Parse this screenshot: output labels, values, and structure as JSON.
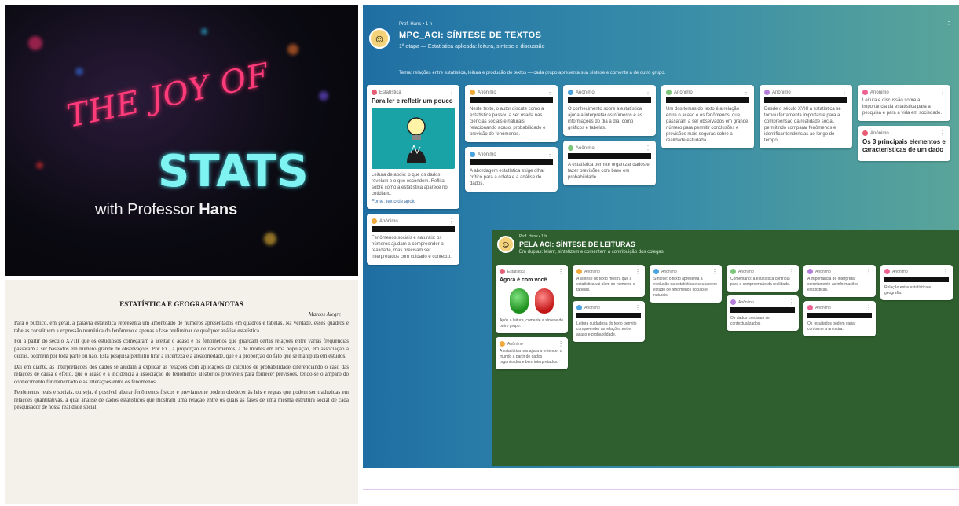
{
  "video": {
    "title_line1": "THE JOY OF",
    "title_line2": "STATS",
    "byline_prefix": "with Professor",
    "byline_name": "Hans"
  },
  "document": {
    "title": "ESTATÍSTICA E GEOGRAFIA/NOTAS",
    "author": "Marcos Alegre",
    "paragraphs": [
      "Para o público, em geral, a palavra estatística representa um amontoado de números apresentados em quadros e tabelas. Na verdade, esses quadros e tabelas constituem a expressão numérica do fenômeno e apenas a fase preliminar de qualquer análise estatística.",
      "Foi a partir do século XVIII que os estudiosos começaram a aceitar o acaso e os fenômenos que guardam certas relações entre várias freqüências passaram a ser baseados em número grande de observações. Por Ex., a proporção de nascimentos, a de mortes em uma população, em associação a outras, ocorrem por toda parte ou não. Esta pesquisa permitiu tirar a incerteza e a aleatoriedade, que é a proporção do fato que se manipula em estudos.",
      "Daí em diante, as interpretações dos dados se ajudam a explicar as relações com aplicações de cálculos de probabilidade diferenciando o caso das relações de causa e efeito, que o acaso é a incidência a associação de fenômenos aleatórios prováveis para fornecer previsões, tendo-se o amparo do conhecimento fundamentado e as interações entre os fenômenos.",
      "Fenômenos reais e sociais, ou seja, é possível alterar fenômenos físicos e previamente podem obedecer às leis e regras que podem ser traduzidas em relações quantitativas, a qual análise de dados estatísticos que mostram uma relação entre os quais as fases de uma mesma estrutura social de cada pesquisador de nossa realidade social."
    ]
  },
  "board1": {
    "owner": "Prof. Hans • 1 h",
    "title": "MPC_ACI: SÍNTESE DE TEXTOS",
    "subtitle": "1ª etapa — Estatística aplicada: leitura, síntese e discussão",
    "description": "Tema: relações entre estatística, leitura e produção de textos — cada grupo apresenta sua síntese e comenta a de outro grupo.",
    "menu": "⋮",
    "columns": [
      {
        "cards": [
          {
            "author": "Estatística",
            "title": "Para ler e refletir um pouco",
            "has_image": true,
            "body": "Leitura de apoio: o que os dados revelam e o que escondem. Reflita sobre como a estatística aparece no cotidiano.",
            "link": "Fonte: texto de apoio"
          },
          {
            "author": "Anônimo",
            "redact": true,
            "body": "Fenômenos sociais e naturais: os números ajudam a compreender a realidade, mas precisam ser interpretados com cuidado e contexto."
          }
        ]
      },
      {
        "cards": [
          {
            "author": "Anônimo",
            "redact": true,
            "body": "Neste texto, o autor discute como a estatística passou a ser usada nas ciências sociais e naturais, relacionando acaso, probabilidade e previsão de fenômenos."
          },
          {
            "author": "Anônimo",
            "redact": true,
            "body": "A abordagem estatística exige olhar crítico para a coleta e a análise de dados."
          }
        ]
      },
      {
        "cards": [
          {
            "author": "Anônimo",
            "redact": true,
            "body": "O conhecimento sobre a estatística ajuda a interpretar os números e as informações do dia a dia, como gráficos e tabelas."
          },
          {
            "author": "Anônimo",
            "redact": true,
            "body": "A estatística permite organizar dados e fazer previsões com base em probabilidade."
          }
        ]
      },
      {
        "cards": [
          {
            "author": "Anônimo",
            "redact": true,
            "body": "Um dos temas do texto é a relação entre o acaso e os fenômenos, que passaram a ser observados em grande número para permitir conclusões e previsões mais seguras sobre a realidade estudada."
          }
        ]
      },
      {
        "cards": [
          {
            "author": "Anônimo",
            "redact": true,
            "body": "Desde o século XVIII a estatística se tornou ferramenta importante para a compreensão da realidade social, permitindo comparar fenômenos e identificar tendências ao longo do tempo."
          }
        ]
      },
      {
        "cards": [
          {
            "author": "Anônimo",
            "body": "Leitura e discussão sobre a importância da estatística para a pesquisa e para a vida em sociedade."
          },
          {
            "author": "Anônimo",
            "title": "Os 3 principais elementos e características de um dado"
          }
        ]
      }
    ]
  },
  "board2": {
    "owner": "Prof. Hans • 1 h",
    "title": "PELA ACI: SÍNTESE DE LEITURAS",
    "subtitle": "Em duplas: leiam, sintetizem e comentem a contribuição dos colegas.",
    "columns": [
      {
        "cards": [
          {
            "author": "Estatística",
            "title": "Agora é com você",
            "traffic_lights": true,
            "body": "Após a leitura, comente a síntese de outro grupo."
          },
          {
            "author": "Anônimo",
            "body": "A estatística nos ajuda a entender o mundo a partir de dados organizados e bem interpretados."
          }
        ]
      },
      {
        "cards": [
          {
            "author": "Anônimo",
            "body": "A síntese do texto mostra que a estatística vai além de números e tabelas."
          },
          {
            "author": "Anônimo",
            "redact": true,
            "body": "Leitura cuidadosa do texto permite compreender as relações entre acaso e probabilidade."
          }
        ]
      },
      {
        "cards": [
          {
            "author": "Anônimo",
            "body": "Síntese: o texto apresenta a evolução da estatística e seu uso no estudo de fenômenos sociais e naturais."
          }
        ]
      },
      {
        "cards": [
          {
            "author": "Anônimo",
            "body": "Comentário: a estatística contribui para a compreensão da realidade."
          },
          {
            "author": "Anônimo",
            "redact": true,
            "body": "Os dados precisam ser contextualizados."
          }
        ]
      },
      {
        "cards": [
          {
            "author": "Anônimo",
            "body": "A importância de interpretar corretamente as informações estatísticas."
          },
          {
            "author": "Anônimo",
            "redact": true,
            "body": "Os resultados podem variar conforme a amostra."
          }
        ]
      },
      {
        "cards": [
          {
            "author": "Anônimo",
            "redact": true,
            "body": "Relação entre estatística e geografia."
          }
        ]
      }
    ]
  },
  "colors": {
    "board1_gradient_start": "#1f6ea3",
    "board1_gradient_end": "#5aa59a",
    "board2_bg": "#2f5f2e",
    "accent_pink": "#ff3b7a",
    "accent_cyan": "#7ff3f2"
  }
}
